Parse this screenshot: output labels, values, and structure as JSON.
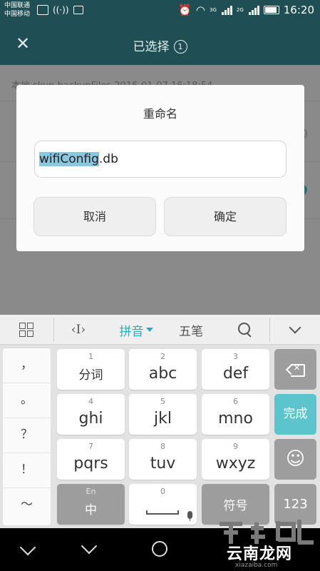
{
  "status_bar": {
    "carrier_1": "中国联通",
    "carrier_2": "中国移动",
    "net_1": "3G",
    "net_2": "2G",
    "time": "16:20"
  },
  "app_bar": {
    "title": "已选择",
    "selected_count": "1"
  },
  "background_list": {
    "row_text": "本地        skun        backupFiles        2016-01-07 16:18:54"
  },
  "dialog": {
    "title": "重命名",
    "filename_selected": "wifiConfig",
    "filename_ext": ".db",
    "cancel_label": "取消",
    "ok_label": "确定"
  },
  "ime_toolbar": {
    "cursor_glyph": "‹I›",
    "pinyin_label": "拼音",
    "wubi_label": "五笔"
  },
  "keyboard": {
    "symbols": [
      "，",
      "。",
      "？",
      "！",
      "～"
    ],
    "keys": [
      {
        "num": "1",
        "label": "分词"
      },
      {
        "num": "2",
        "label": "abc"
      },
      {
        "num": "3",
        "label": "def"
      },
      {
        "num": "4",
        "label": "ghi"
      },
      {
        "num": "5",
        "label": "jkl"
      },
      {
        "num": "6",
        "label": "mno"
      },
      {
        "num": "7",
        "label": "pqrs"
      },
      {
        "num": "8",
        "label": "tuv"
      },
      {
        "num": "9",
        "label": "wxyz"
      }
    ],
    "en_cn": {
      "top": "En",
      "label": "中"
    },
    "space_num": "0",
    "fuhao": "符号",
    "done": "完成",
    "num_toggle": "123",
    "emoji": "☺"
  },
  "watermark": {
    "text": "云南龙网",
    "url": "xiazaiba.com"
  },
  "colors": {
    "teal_bar": "#1f4f54",
    "accent": "#5cc4cd",
    "pinyin": "#31a9bd"
  }
}
